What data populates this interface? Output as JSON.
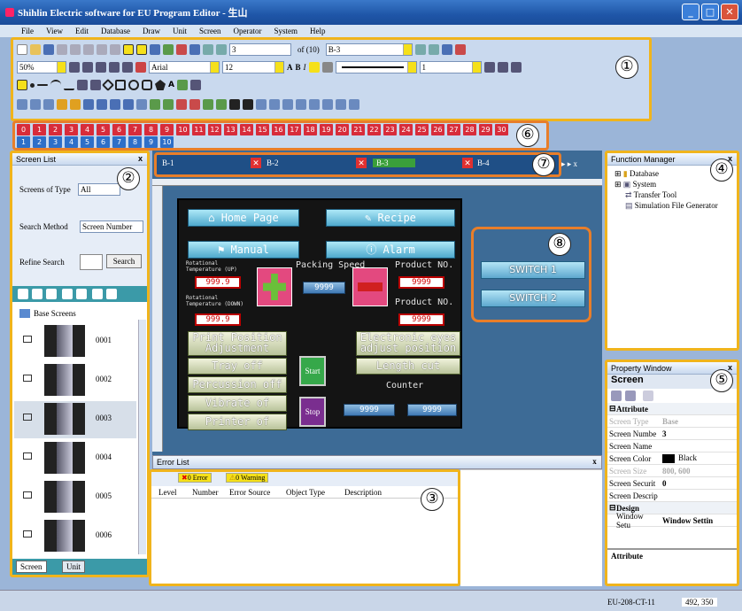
{
  "title": "Shihlin Electric software for EU Program Editor - 生山",
  "menu": [
    "File",
    "View",
    "Edit",
    "Database",
    "Draw",
    "Unit",
    "Screen",
    "Operator",
    "System",
    "Help"
  ],
  "toolbar": {
    "page_value": "3",
    "page_of": "of (10)",
    "screen_select": "B-3",
    "zoom": "50%",
    "font": "Arial",
    "font_size": "12",
    "line_width": "1",
    "bold": "B",
    "italic": "I",
    "text_a": "A"
  },
  "callouts": [
    "①",
    "②",
    "③",
    "④",
    "⑤",
    "⑥",
    "⑦",
    "⑧"
  ],
  "numbered_buttons_row1": [
    "0",
    "1",
    "2",
    "3",
    "4",
    "5",
    "6",
    "7",
    "8",
    "9",
    "10",
    "11",
    "12",
    "13",
    "14",
    "15",
    "16",
    "17",
    "18",
    "19",
    "20",
    "21",
    "22",
    "23",
    "24",
    "25",
    "26",
    "27",
    "28",
    "29",
    "30"
  ],
  "numbered_buttons_row2": [
    "1",
    "2",
    "3",
    "4",
    "5",
    "6",
    "7",
    "8",
    "9",
    "10"
  ],
  "screen_list": {
    "title": "Screen List",
    "screens_of_type_label": "Screens of Type",
    "screens_of_type_value": "All",
    "search_method_label": "Search Method",
    "search_method_value": "Screen Number",
    "refine_search_label": "Refine Search",
    "search_button": "Search",
    "base_screens_label": "Base Screens",
    "items": [
      "0001",
      "0002",
      "0003",
      "0004",
      "0005",
      "0006"
    ],
    "tab_screen": "Screen",
    "tab_unit": "Unit"
  },
  "tabs": [
    "B-1",
    "B-2",
    "B-3",
    "B-4"
  ],
  "hmi": {
    "home_page": "Home Page",
    "recipe": "Recipe",
    "manual": "Manual",
    "alarm": "Alarm",
    "rot_temp_up": "Rotational Temperature (UP)",
    "rot_temp_down": "Rotational Temperature (DOWN)",
    "val_999_a": "999.9",
    "val_999_b": "999.9",
    "packing_speed": "Packing  Speed",
    "product_no_a": "Product  NO.",
    "product_no_b": "Product  NO.",
    "val_9999_mid": "9999",
    "val_9999_ra": "9999",
    "val_9999_rb": "9999",
    "print_position": "Print Position Adjustment",
    "tray_off": "Tray off",
    "percussion_off": "Percussion off",
    "vibrate_of": "Vibrate of",
    "printer_of": "Printer of",
    "electronic_eyes": "Electronic eyes adjust position",
    "length_cut": "Length cut",
    "counter": "Counter",
    "start": "Start",
    "stop": "Stop",
    "counter_a": "9999",
    "counter_b": "9999",
    "switch1": "SWITCH 1",
    "switch2": "SWITCH 2"
  },
  "error_list": {
    "title": "Error List",
    "errors_badge": "0 Error",
    "warnings_badge": "0 Warning",
    "columns": [
      "Level",
      "Number",
      "Error Source",
      "Object Type",
      "Description"
    ]
  },
  "function_manager": {
    "title": "Function Manager",
    "items": [
      "Database",
      "System",
      "Transfer Tool",
      "Simulation File Generator"
    ]
  },
  "property_window": {
    "title": "Property Window",
    "object": "Screen",
    "section_attribute": "Attribute",
    "section_design": "Design",
    "rows": [
      {
        "k": "Screen Type",
        "v": "Base",
        "dim": true
      },
      {
        "k": "Screen Numbe",
        "v": "3",
        "dim": false
      },
      {
        "k": "Screen Name",
        "v": "",
        "dim": false
      },
      {
        "k": "Screen Color",
        "v": "Black",
        "dim": false
      },
      {
        "k": "Screen Size",
        "v": "800, 600",
        "dim": true
      },
      {
        "k": "Screen Securit",
        "v": "0",
        "dim": false
      },
      {
        "k": "Screen Descrip",
        "v": "",
        "dim": false
      }
    ],
    "window_setup_key": "Window Setu",
    "window_setup_val": "Window Settin",
    "footer": "Attribute"
  },
  "status": {
    "model": "EU-208-CT-11",
    "coords": "492, 350"
  },
  "colors": {
    "highlight": "#f0b41c",
    "orange": "#e87e2a",
    "hmi_bg": "#141414"
  }
}
